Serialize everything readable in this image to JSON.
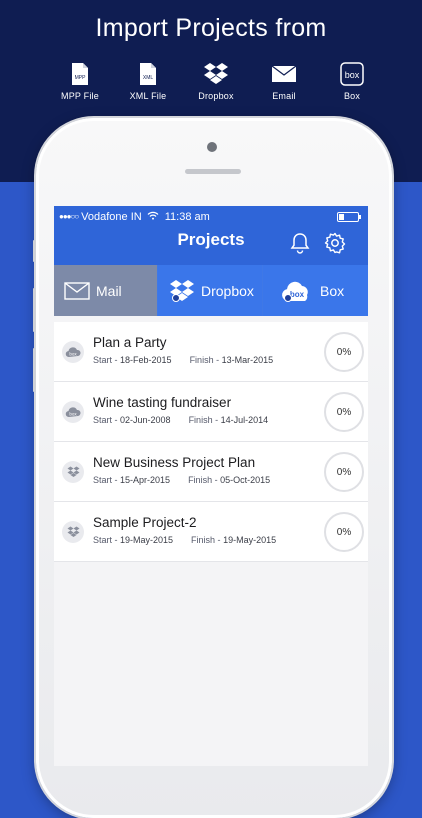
{
  "promo": {
    "headline": "Import Projects from",
    "sources": [
      {
        "icon": "mpp-file-icon",
        "label": "MPP File",
        "glyph": "MPP"
      },
      {
        "icon": "xml-file-icon",
        "label": "XML File",
        "glyph": "XML"
      },
      {
        "icon": "dropbox-icon",
        "label": "Dropbox"
      },
      {
        "icon": "email-icon",
        "label": "Email"
      },
      {
        "icon": "box-icon",
        "label": "Box",
        "glyph": "box"
      }
    ]
  },
  "status_bar": {
    "signal": "●●●○○",
    "carrier": "Vodafone IN",
    "time": "11:38 am"
  },
  "nav": {
    "title": "Projects",
    "accent": "#2f65d8"
  },
  "tabs": [
    {
      "label": "Mail",
      "icon": "mail-icon",
      "selected": true
    },
    {
      "label": "Dropbox",
      "icon": "dropbox-icon",
      "selected": false
    },
    {
      "label": "Box",
      "icon": "box-cloud-icon",
      "selected": false,
      "glyph": "box"
    }
  ],
  "projects": [
    {
      "name": "Plan a Party",
      "source": "box",
      "start_label": "Start - ",
      "start": "18-Feb-2015",
      "finish_label": "Finish - ",
      "finish": "13-Mar-2015",
      "progress": "0%"
    },
    {
      "name": "Wine tasting fundraiser",
      "source": "box",
      "start_label": "Start - ",
      "start": "02-Jun-2008",
      "finish_label": "Finish - ",
      "finish": "14-Jul-2014",
      "progress": "0%"
    },
    {
      "name": "New Business Project Plan",
      "source": "dropbox",
      "start_label": "Start - ",
      "start": "15-Apr-2015",
      "finish_label": "Finish - ",
      "finish": "05-Oct-2015",
      "progress": "0%"
    },
    {
      "name": "Sample Project-2",
      "source": "dropbox",
      "start_label": "Start - ",
      "start": "19-May-2015",
      "finish_label": "Finish - ",
      "finish": "19-May-2015",
      "progress": "0%"
    }
  ]
}
